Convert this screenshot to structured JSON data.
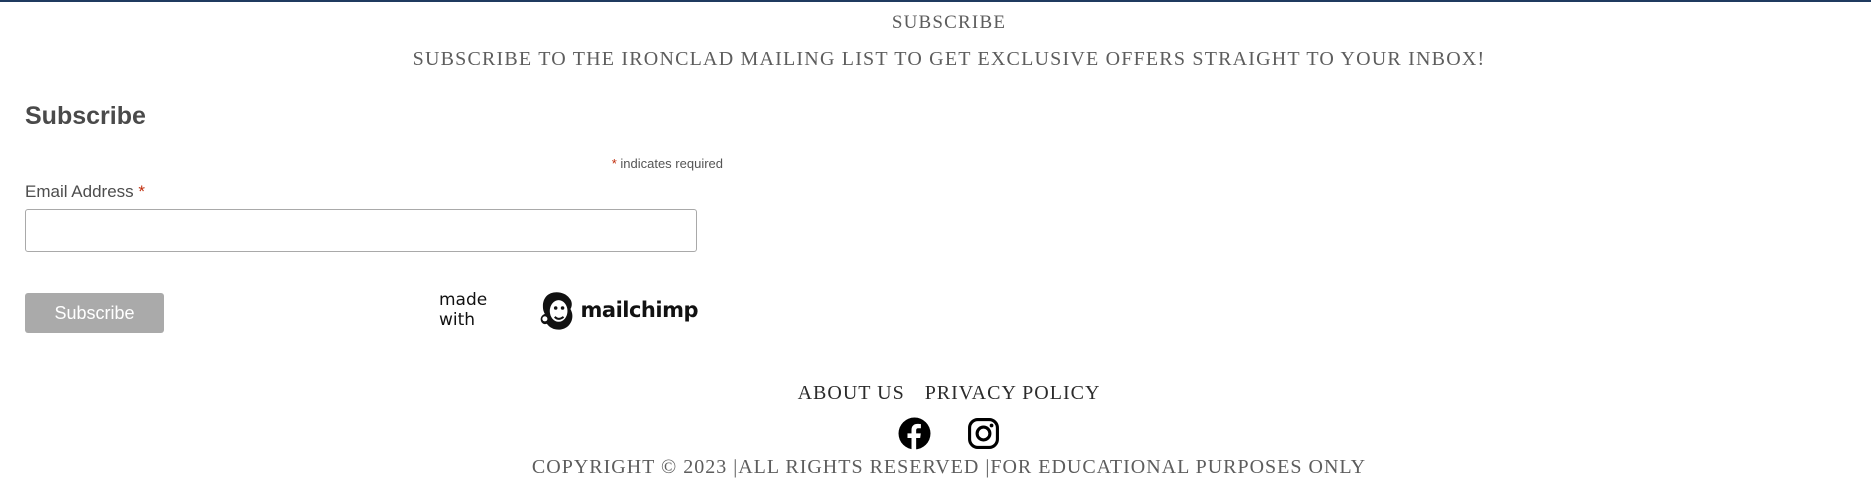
{
  "colors": {
    "top_rule": "#1f3a5f",
    "heading_text": "#5d5d5d",
    "required_asterisk": "#c02b0a",
    "button_bg": "#aaaaaa",
    "button_text": "#ffffff"
  },
  "signup_section": {
    "heading": "SUBSCRIBE",
    "tagline": "SUBSCRIBE TO THE IRONCLAD MAILING LIST TO GET EXCLUSIVE OFFERS STRAIGHT TO YOUR INBOX!"
  },
  "form": {
    "title": "Subscribe",
    "required_asterisk": "*",
    "required_note": " indicates required",
    "email_label": "Email Address ",
    "email_value": "",
    "email_placeholder": "",
    "submit_label": "Subscribe"
  },
  "mailchimp_badge": {
    "made_with": "made with",
    "brand": "mailchimp",
    "icon": "mailchimp-freddie-icon"
  },
  "footer": {
    "links": [
      "ABOUT US",
      "PRIVACY POLICY"
    ],
    "social_icons": [
      "facebook-icon",
      "instagram-icon"
    ],
    "copyright": "COPYRIGHT © 2023 |ALL RIGHTS RESERVED |FOR EDUCATIONAL PURPOSES ONLY"
  }
}
